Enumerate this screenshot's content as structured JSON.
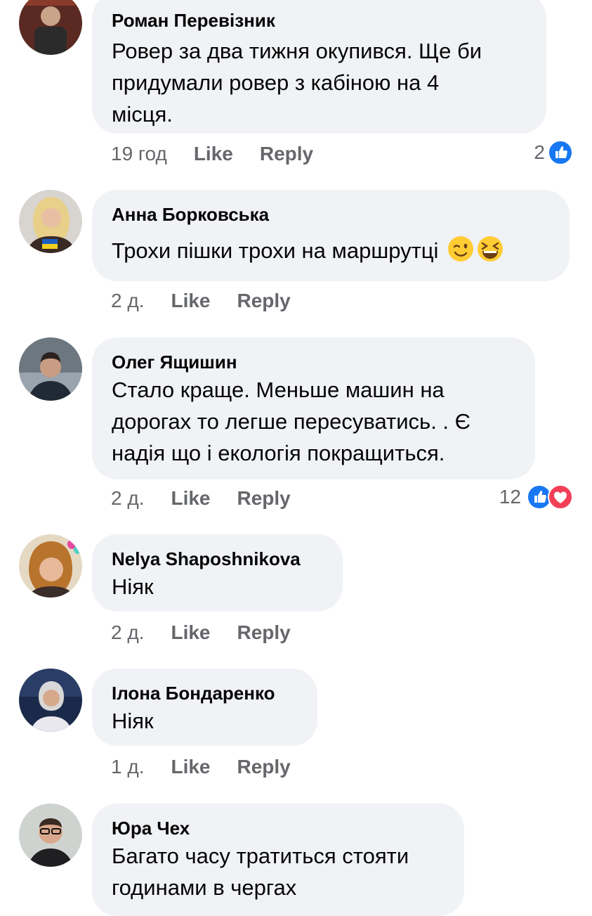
{
  "comments": [
    {
      "author": "Роман Перевізник",
      "lines": [
        "Ровер за два тижня окупився. Ще би",
        "придумали ровер з кабіною на 4",
        "місця."
      ],
      "time": "19 год",
      "like": "Like",
      "reply": "Reply",
      "reaction_count": "2",
      "reactions": [
        "like-icon"
      ]
    },
    {
      "author": "Анна Борковська",
      "lines": [
        "Трохи пішки трохи на маршрутці"
      ],
      "emojis": [
        "winking-face-emoji",
        "grinning-squinting-face-emoji"
      ],
      "time": "2 д.",
      "like": "Like",
      "reply": "Reply"
    },
    {
      "author": "Олег Ящишин",
      "lines": [
        "Стало краще. Меньше машин на",
        "дорогах то легше пересуватись. . Є",
        "надія що і екологія покращиться."
      ],
      "time": "2 д.",
      "like": "Like",
      "reply": "Reply",
      "reaction_count": "12",
      "reactions": [
        "like-icon",
        "love-icon"
      ]
    },
    {
      "author": "Nelya Shaposhnikova",
      "lines": [
        "Ніяк"
      ],
      "time": "2 д.",
      "like": "Like",
      "reply": "Reply"
    },
    {
      "author": "Ілона Бондаренко",
      "lines": [
        "Ніяк"
      ],
      "time": "1 д.",
      "like": "Like",
      "reply": "Reply"
    },
    {
      "author": "Юра Чех",
      "lines": [
        "Багато часу тратиться стояти",
        "годинами в чергах"
      ]
    }
  ],
  "colors": {
    "bubble": "#f0f2f5",
    "meta": "#65676b",
    "like_blue": "#1877f2",
    "love_red": "#f33e58"
  }
}
